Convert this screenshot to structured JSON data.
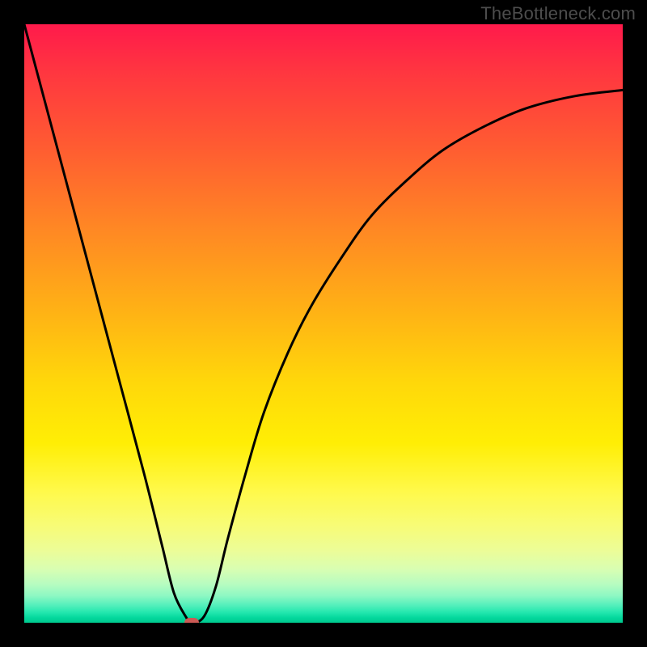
{
  "watermark": "TheBottleneck.com",
  "chart_data": {
    "type": "line",
    "title": "",
    "xlabel": "",
    "ylabel": "",
    "xlim": [
      0,
      100
    ],
    "ylim": [
      0,
      100
    ],
    "series": [
      {
        "name": "curve",
        "x": [
          0,
          4,
          8,
          12,
          16,
          20,
          23,
          25,
          27,
          28,
          30,
          32,
          34,
          37,
          40,
          44,
          48,
          53,
          58,
          64,
          70,
          77,
          84,
          92,
          100
        ],
        "values": [
          100,
          85,
          70,
          55,
          40,
          25,
          13,
          5,
          1,
          0,
          1,
          6,
          14,
          25,
          35,
          45,
          53,
          61,
          68,
          74,
          79,
          83,
          86,
          88,
          89
        ]
      }
    ],
    "marker": {
      "x": 28,
      "y": 0,
      "color": "#cc5a55"
    },
    "background_gradient": {
      "top": "#ff1a4b",
      "mid_upper": "#ff8724",
      "mid": "#ffd80a",
      "mid_lower": "#fff94a",
      "bottom": "#00c98e"
    }
  }
}
